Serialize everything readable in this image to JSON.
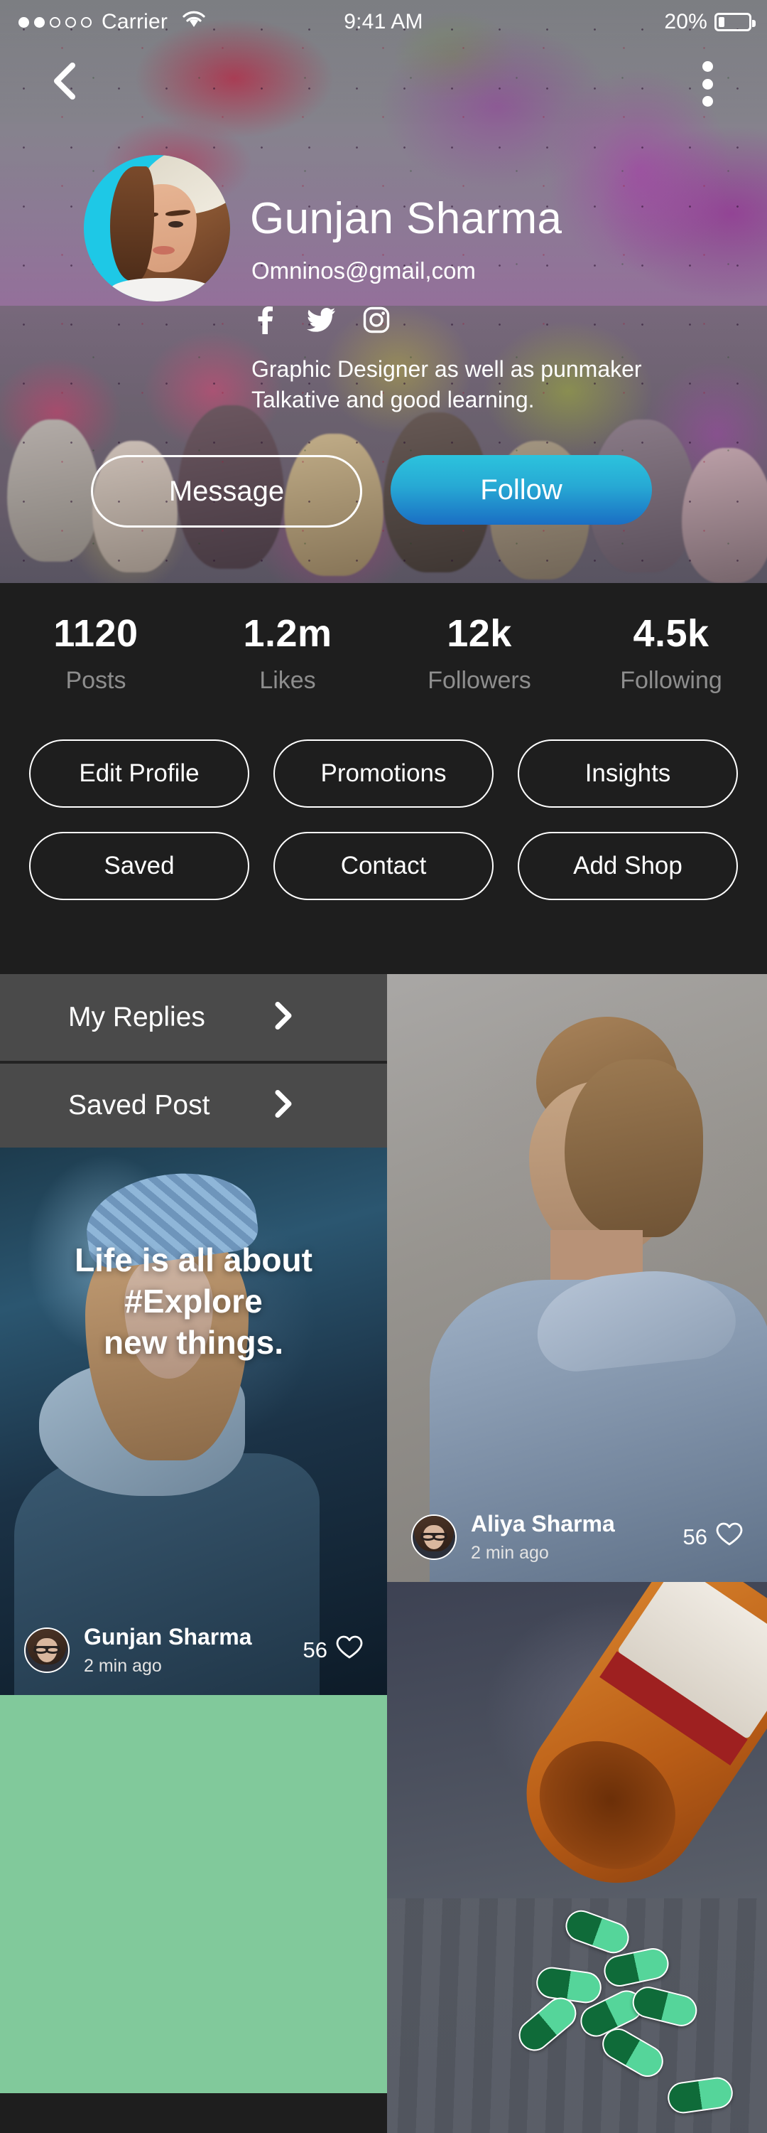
{
  "status_bar": {
    "carrier": "Carrier",
    "signal_dots_total": 5,
    "signal_dots_filled": 2,
    "wifi_icon": "wifi-icon",
    "time": "9:41 AM",
    "battery_percent": "20%",
    "battery_icon": "battery-icon"
  },
  "nav": {
    "back_icon": "back-chevron-icon",
    "more_icon": "more-vertical-icon"
  },
  "profile": {
    "avatar_icon": "profile-avatar",
    "name": "Gunjan Sharma",
    "email": "Omninos@gmail,com",
    "bio_line1": "Graphic Designer as well as punmaker",
    "bio_line2": "Talkative and good learning.",
    "socials": [
      {
        "name": "facebook-icon",
        "glyph": "f"
      },
      {
        "name": "twitter-icon",
        "glyph": "t"
      },
      {
        "name": "instagram-icon",
        "glyph": "i"
      }
    ],
    "message_label": "Message",
    "follow_label": "Follow",
    "follow_gradient_start": "#2cc3dd",
    "follow_gradient_end": "#1a6ec4"
  },
  "stats": [
    {
      "value": "1120",
      "label": "Posts"
    },
    {
      "value": "1.2m",
      "label": "Likes"
    },
    {
      "value": "12k",
      "label": "Followers"
    },
    {
      "value": "4.5k",
      "label": "Following"
    }
  ],
  "action_buttons": [
    [
      "Edit Profile",
      "Promotions",
      "Insights"
    ],
    [
      "Saved",
      "Contact",
      "Add Shop"
    ]
  ],
  "nav_rows": [
    {
      "label": "My Replies",
      "chevron": "chevron-right-icon"
    },
    {
      "label": "Saved Post",
      "chevron": "chevron-right-icon"
    }
  ],
  "posts": {
    "featured": {
      "overlay_line1": "Life is all about",
      "overlay_line2": "#Explore",
      "overlay_line3": "new things.",
      "author": "Gunjan Sharma",
      "time": "2 min ago",
      "likes": "56",
      "like_icon": "heart-outline-icon",
      "image_icon": "woman-in-bucket-hat-photo"
    },
    "right_top": {
      "author": "Aliya Sharma",
      "time": "2 min ago",
      "likes": "56",
      "like_icon": "heart-outline-icon",
      "image_icon": "woman-in-denim-jacket-photo"
    },
    "right_bottom": {
      "image_icon": "pill-bottle-photo"
    },
    "green_tile": {
      "color": "#81c99b"
    }
  },
  "theme": {
    "dark_panel": "#1e1e1e",
    "nav_row_bg": "#4a4a4a",
    "text_primary": "#ffffff",
    "text_muted": "#8e8e8e"
  }
}
